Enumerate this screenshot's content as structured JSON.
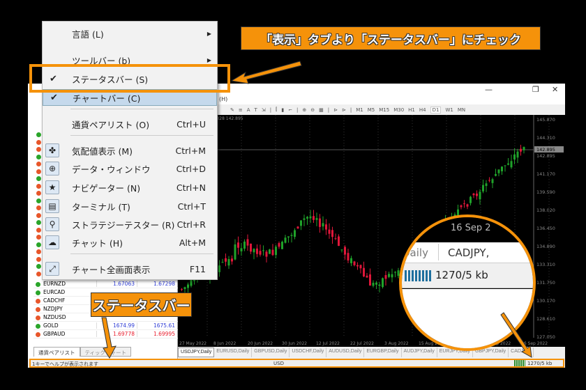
{
  "window": {
    "sub_title": "(H)",
    "minimize": "—",
    "restore": "❐",
    "close": "✕"
  },
  "toolbar": {
    "timeframes": [
      "M1",
      "M5",
      "M15",
      "M30",
      "H1",
      "H4",
      "D1",
      "W1",
      "MN"
    ],
    "active_tf": "D1"
  },
  "chart": {
    "ohlc_readout": "417 143.686 142.828 142.895",
    "current_price": "142.895",
    "price_labels": [
      "145.870",
      "144.310",
      "142.895",
      "141.170",
      "139.590",
      "138.020",
      "136.450",
      "134.890",
      "133.310",
      "131.750",
      "130.170",
      "128.610",
      "127.050"
    ],
    "date_labels": [
      "27 May 2022",
      "8 Jun 2022",
      "20 Jun 2022",
      "30 Jun 2022",
      "12 Jul 2022",
      "22 Jul 2022",
      "3 Aug 2022",
      "15 Aug 2022",
      "25 Aug 2022",
      "6 Sep 2022",
      "16 Sep 2022"
    ],
    "bull_color": "#1fa22a",
    "bear_color": "#e0173a"
  },
  "chart_tabs": [
    "USDJPY,Daily",
    "EURUSD,Daily",
    "GBPUSD,Daily",
    "USDCHF,Daily",
    "AUDUSD,Daily",
    "EURGBP,Daily",
    "AUDJPY,Daily",
    "EURJPY,Daily",
    "GBPJPY,Daily",
    "CADJPY,"
  ],
  "market_watch": [
    {
      "symbol": "EURNZD",
      "bid": "1.67063",
      "ask": "1.67298",
      "dir": "up"
    },
    {
      "symbol": "EURCAD",
      "bid": "",
      "ask": "",
      "dir": "up"
    },
    {
      "symbol": "CADCHF",
      "bid": "",
      "ask": "",
      "dir": "down"
    },
    {
      "symbol": "NZDJPY",
      "bid": "",
      "ask": "",
      "dir": "down"
    },
    {
      "symbol": "NZDUSD",
      "bid": "",
      "ask": "",
      "dir": "down"
    },
    {
      "symbol": "GOLD",
      "bid": "1674.99",
      "ask": "1675.61",
      "dir": "up"
    },
    {
      "symbol": "GBPAUD",
      "bid": "1.69778",
      "ask": "1.69995",
      "dir": "down"
    }
  ],
  "left_tabs": [
    "通貨ペアリスト",
    "ティックチャート"
  ],
  "statusbar": {
    "help": "1キーでヘルプが表示されます",
    "profile": "USD",
    "traffic": "1270/5 kb"
  },
  "menu": {
    "items": [
      {
        "label": "言語 (L)",
        "shortcut": "",
        "submenu": true
      },
      {
        "label": "ツールバー (b)",
        "shortcut": "",
        "submenu": true
      },
      {
        "label": "ステータスバー (S)",
        "shortcut": "",
        "checked": true
      },
      {
        "label": "チャートバー (C)",
        "shortcut": "",
        "checked": true
      },
      {
        "label": "通貨ペアリスト (O)",
        "shortcut": "Ctrl+U"
      },
      {
        "label": "気配値表示 (M)",
        "shortcut": "Ctrl+M",
        "icon": "market-watch-icon"
      },
      {
        "label": "データ・ウィンドウ",
        "shortcut": "Ctrl+D",
        "icon": "crosshair-icon"
      },
      {
        "label": "ナビゲーター (N)",
        "shortcut": "Ctrl+N",
        "icon": "navigator-star-icon"
      },
      {
        "label": "ターミナル (T)",
        "shortcut": "Ctrl+T",
        "icon": "terminal-icon"
      },
      {
        "label": "ストラテジーテスター (R)",
        "shortcut": "Ctrl+R",
        "icon": "tester-icon"
      },
      {
        "label": "チャット (H)",
        "shortcut": "Alt+M",
        "icon": "chat-icon"
      },
      {
        "label": "チャート全画面表示",
        "shortcut": "F11",
        "icon": "fullscreen-icon"
      }
    ]
  },
  "annotations": {
    "top_callout": "「表示」タブより「ステータスバー」にチェック",
    "status_callout": "ステータスバー",
    "magnified_date": "16 Sep 2",
    "magnified_tab1": "Daily",
    "magnified_tab2": "CADJPY,",
    "magnified_traffic": "1270/5 kb",
    "accent": "#f5920a"
  }
}
